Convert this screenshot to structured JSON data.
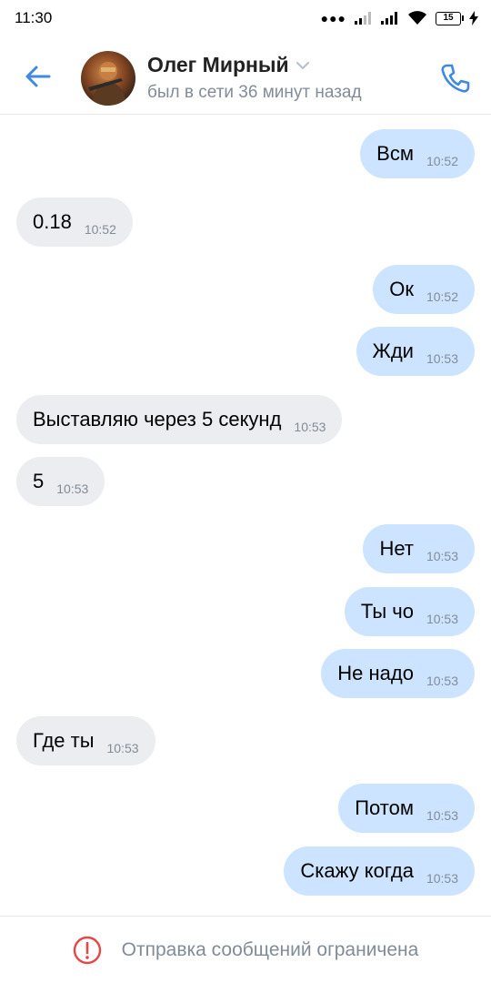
{
  "status_bar": {
    "time": "11:30",
    "battery": "15"
  },
  "header": {
    "name": "Олег Мирный",
    "status": "был в сети 36 минут назад",
    "accent_color": "#3f8ae0"
  },
  "messages": [
    {
      "dir": "out",
      "text": "Всм",
      "time": "10:52"
    },
    {
      "dir": "in",
      "text": "0.18",
      "time": "10:52"
    },
    {
      "dir": "out",
      "text": "Ок",
      "time": "10:52"
    },
    {
      "dir": "out",
      "text": "Жди",
      "time": "10:53"
    },
    {
      "dir": "in",
      "text": "Выставляю через 5 секунд",
      "time": "10:53"
    },
    {
      "dir": "in",
      "text": "5",
      "time": "10:53"
    },
    {
      "dir": "out",
      "text": "Нет",
      "time": "10:53"
    },
    {
      "dir": "out",
      "text": "Ты чо",
      "time": "10:53"
    },
    {
      "dir": "out",
      "text": "Не надо",
      "time": "10:53"
    },
    {
      "dir": "in",
      "text": "Где ты",
      "time": "10:53"
    },
    {
      "dir": "out",
      "text": "Потом",
      "time": "10:53"
    },
    {
      "dir": "out",
      "text": "Скажу когда",
      "time": "10:53"
    }
  ],
  "footer": {
    "text": "Отправка сообщений ограничена",
    "icon": "warning-icon",
    "icon_color": "#e64646"
  }
}
